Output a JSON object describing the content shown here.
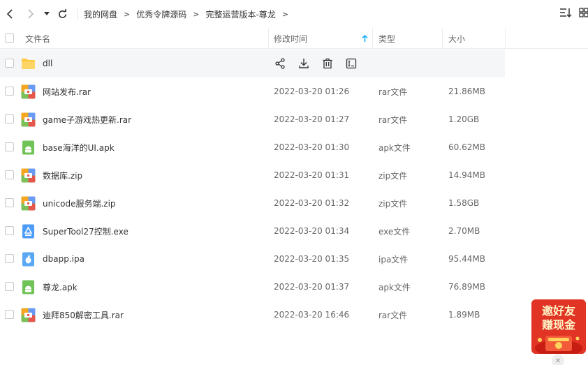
{
  "breadcrumb": [
    "我的网盘",
    "优秀令牌源码",
    "完整运营版本-尊龙"
  ],
  "breadcrumb_separator": ">",
  "columns": {
    "name": "文件名",
    "modified": "修改时间",
    "type": "类型",
    "size": "大小"
  },
  "files": [
    {
      "name": "dll",
      "icon": "folder-icon",
      "modified": "",
      "type": "",
      "size": ""
    },
    {
      "name": "网站发布.rar",
      "icon": "archive-icon",
      "modified": "2022-03-20 01:26",
      "type": "rar文件",
      "size": "21.86MB"
    },
    {
      "name": "game子游戏热更新.rar",
      "icon": "archive-icon",
      "modified": "2022-03-20 01:27",
      "type": "rar文件",
      "size": "1.20GB"
    },
    {
      "name": "base海洋的UI.apk",
      "icon": "apk-icon",
      "modified": "2022-03-20 01:30",
      "type": "apk文件",
      "size": "60.62MB"
    },
    {
      "name": "数据库.zip",
      "icon": "archive-icon",
      "modified": "2022-03-20 01:31",
      "type": "zip文件",
      "size": "14.94MB"
    },
    {
      "name": "unicode服务端.zip",
      "icon": "archive-icon",
      "modified": "2022-03-20 01:32",
      "type": "zip文件",
      "size": "1.58GB"
    },
    {
      "name": "SuperTool27控制.exe",
      "icon": "exe-icon",
      "modified": "2022-03-20 01:34",
      "type": "exe文件",
      "size": "2.70MB"
    },
    {
      "name": "dbapp.ipa",
      "icon": "ipa-icon",
      "modified": "2022-03-20 01:35",
      "type": "ipa文件",
      "size": "95.44MB"
    },
    {
      "name": "尊龙.apk",
      "icon": "apk-icon",
      "modified": "2022-03-20 01:37",
      "type": "apk文件",
      "size": "76.89MB"
    },
    {
      "name": "迪拜850解密工具.rar",
      "icon": "archive-icon",
      "modified": "2022-03-20 16:46",
      "type": "rar文件",
      "size": "1.89MB"
    }
  ],
  "promo": {
    "line1": "邀好友",
    "line2": "赚现金"
  },
  "colors": {
    "accent": "#06a7ff",
    "folder": "#ffc53d",
    "promo": "#e23425"
  }
}
